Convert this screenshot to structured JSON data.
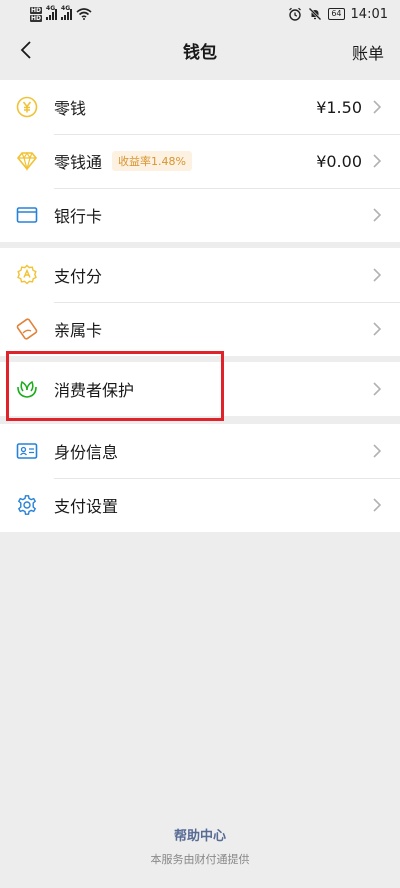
{
  "status_bar": {
    "network_a": "4G",
    "network_b": "4G",
    "hd_a": "HD",
    "hd_b": "HD",
    "battery": "64",
    "time": "14:01"
  },
  "nav": {
    "title": "钱包",
    "right_action": "账单"
  },
  "groups": [
    {
      "items": [
        {
          "label": "零钱",
          "value": "¥1.50",
          "icon": "yuan-coin-icon"
        },
        {
          "label": "零钱通",
          "badge": "收益率1.48%",
          "value": "¥0.00",
          "icon": "diamond-icon"
        },
        {
          "label": "银行卡",
          "icon": "bank-card-icon"
        }
      ]
    },
    {
      "items": [
        {
          "label": "支付分",
          "icon": "pay-score-icon"
        },
        {
          "label": "亲属卡",
          "icon": "family-card-icon"
        }
      ]
    },
    {
      "items": [
        {
          "label": "消费者保护",
          "icon": "consumer-protection-icon"
        }
      ]
    },
    {
      "items": [
        {
          "label": "身份信息",
          "icon": "id-card-icon"
        },
        {
          "label": "支付设置",
          "icon": "settings-gear-icon"
        }
      ]
    }
  ],
  "footer": {
    "help": "帮助中心",
    "provider": "本服务由财付通提供"
  },
  "colors": {
    "background": "#ededed",
    "icon_yellow": "#f1c232",
    "icon_blue": "#2782d7",
    "icon_orange": "#e0823a",
    "icon_green": "#1aad19",
    "badge_text": "#d8952f",
    "link": "#576b95",
    "highlight_red": "#e0232b"
  }
}
